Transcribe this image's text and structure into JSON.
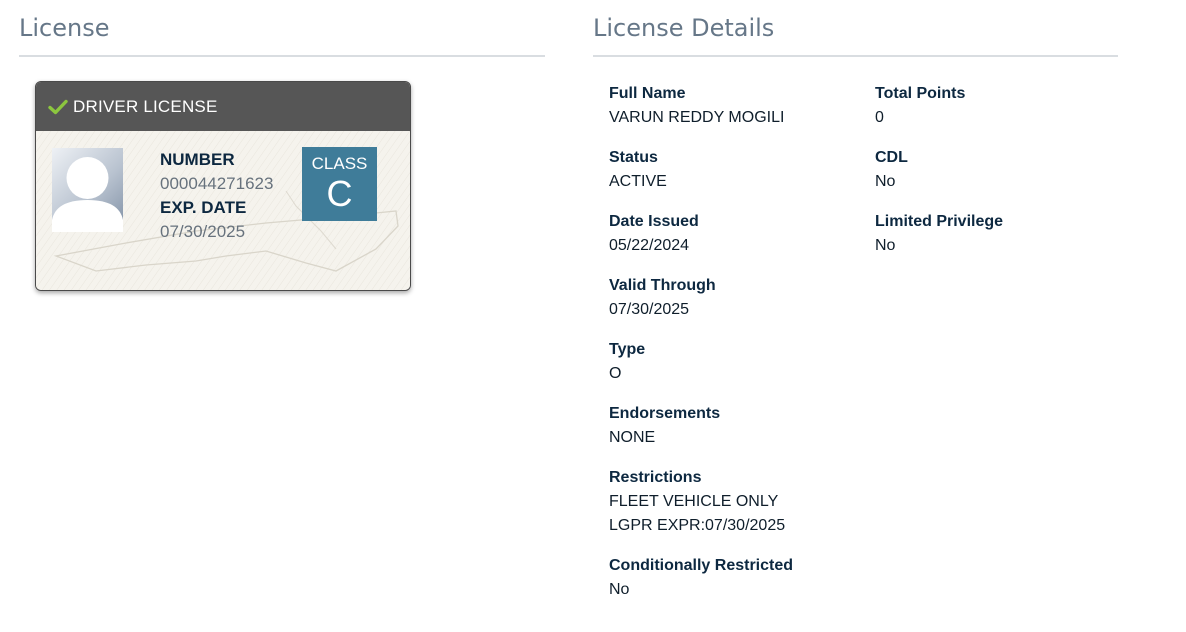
{
  "license_section": {
    "title": "License"
  },
  "details_section": {
    "title": "License Details"
  },
  "card": {
    "header_label": "DRIVER LICENSE",
    "number_label": "NUMBER",
    "number_value": "000044271623",
    "exp_label": "EXP. DATE",
    "exp_value": "07/30/2025",
    "class_label": "CLASS",
    "class_value": "C",
    "icons": {
      "check": "check-icon",
      "avatar": "avatar-placeholder"
    },
    "colors": {
      "header_bg": "#565656",
      "class_bg": "#3f7c99",
      "check": "#8cc63f"
    }
  },
  "details": {
    "full_name": {
      "label": "Full Name",
      "value": "VARUN REDDY MOGILI"
    },
    "status": {
      "label": "Status",
      "value": "ACTIVE"
    },
    "date_issued": {
      "label": "Date Issued",
      "value": "05/22/2024"
    },
    "valid_through": {
      "label": "Valid Through",
      "value": "07/30/2025"
    },
    "type": {
      "label": "Type",
      "value": "O"
    },
    "endorsements": {
      "label": "Endorsements",
      "value": "NONE"
    },
    "restrictions": {
      "label": "Restrictions",
      "values": [
        "FLEET VEHICLE ONLY",
        "LGPR EXPR:07/30/2025"
      ]
    },
    "conditionally_restricted": {
      "label": "Conditionally Restricted",
      "value": "No"
    },
    "total_points": {
      "label": "Total Points",
      "value": "0"
    },
    "cdl": {
      "label": "CDL",
      "value": "No"
    },
    "limited_privilege": {
      "label": "Limited Privilege",
      "value": "No"
    }
  }
}
